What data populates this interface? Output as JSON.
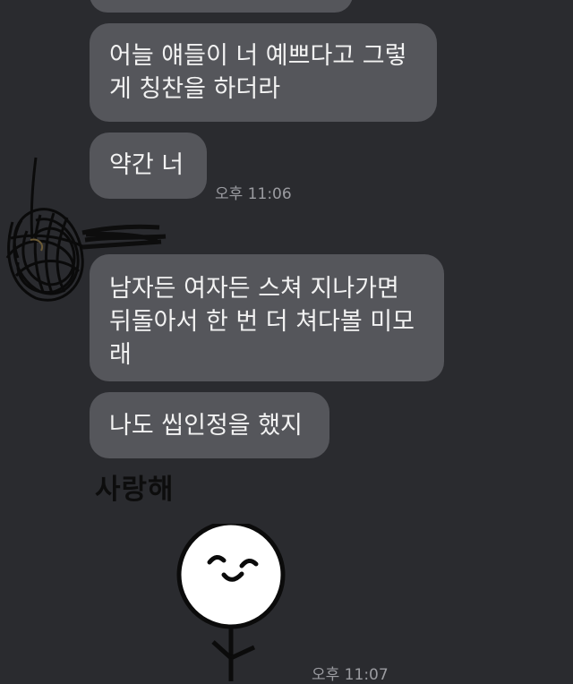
{
  "chat": {
    "messages": [
      {
        "text": ""
      },
      {
        "text": "어늘 얘들이 너 예쁘다고 그렇\n게 칭찬을 하더라"
      },
      {
        "text": "약간 너",
        "time": "오후 11:06"
      },
      {
        "text": "남자든 여자든 스쳐 지나가면\n뒤돌아서 한 번 더 쳐다볼 미모\n래"
      },
      {
        "text": "나도 씹인정을 했지"
      }
    ],
    "sticker": {
      "text": "사랑해",
      "icon": "smiley-stick-figure-sticker",
      "time": "오후 11:07"
    }
  },
  "colors": {
    "background": "#2a2b2f",
    "bubble": "#55565b",
    "bubble_text": "#f2f2f2",
    "timestamp": "#9b9ca1"
  }
}
